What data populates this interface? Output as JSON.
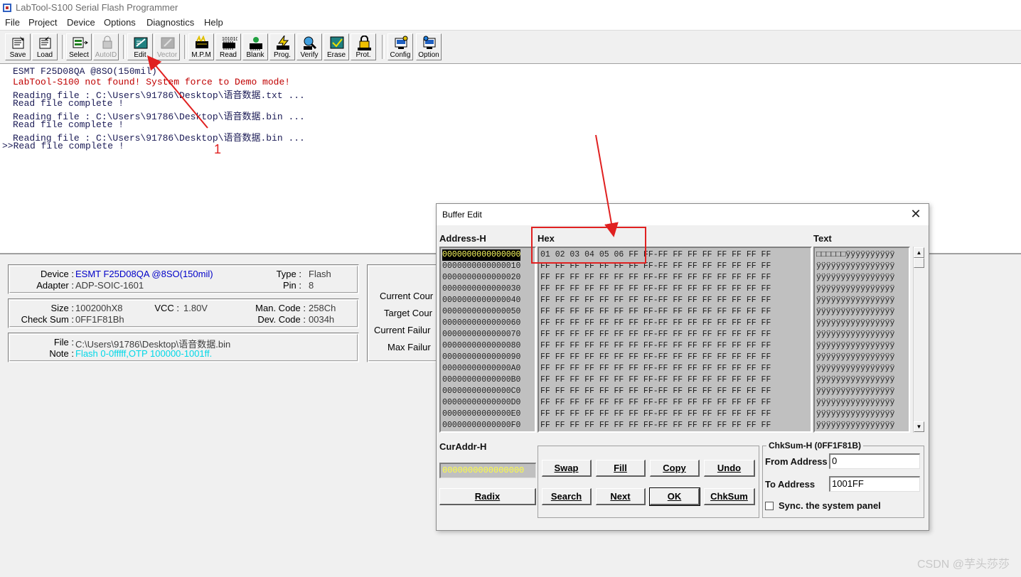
{
  "window": {
    "title": "LabTool-S100 Serial Flash Programmer"
  },
  "menu": [
    "File",
    "Project",
    "Device",
    "Options",
    "Diagnostics",
    "Help"
  ],
  "toolbar": [
    {
      "label": "Save",
      "icon": "save-icon"
    },
    {
      "label": "Load",
      "icon": "load-icon"
    },
    {
      "label": "Select",
      "icon": "select-icon"
    },
    {
      "label": "AutoID",
      "icon": "autoid-icon",
      "disabled": true
    },
    {
      "label": "Edit",
      "icon": "edit-icon"
    },
    {
      "label": "Vector",
      "icon": "vector-icon",
      "disabled": true
    },
    {
      "label": "M.P.M",
      "icon": "mpm-icon"
    },
    {
      "label": "Read",
      "icon": "read-icon",
      "badge": "101010"
    },
    {
      "label": "Blank",
      "icon": "blank-icon"
    },
    {
      "label": "Prog.",
      "icon": "prog-icon"
    },
    {
      "label": "Verify",
      "icon": "verify-icon"
    },
    {
      "label": "Erase",
      "icon": "erase-icon"
    },
    {
      "label": "Prot.",
      "icon": "prot-icon"
    },
    {
      "label": "Config",
      "icon": "config-icon"
    },
    {
      "label": "Option",
      "icon": "option-icon"
    }
  ],
  "log": [
    "ESMT F25D08QA @8SO(150mil)",
    "LabTool-S100 not found! System force to Demo mode!",
    "Reading file : C:\\Users\\91786\\Desktop\\语音数据.txt ...",
    "Read file complete !",
    "Reading file : C:\\Users\\91786\\Desktop\\语音数据.bin ...",
    "Read file complete !",
    "Reading file : C:\\Users\\91786\\Desktop\\语音数据.bin ...",
    ">>Read file complete !"
  ],
  "annotation": {
    "number": "1"
  },
  "status": {
    "device_label": "Device :",
    "device": "ESMT F25D08QA @8SO(150mil)",
    "adapter_label": "Adapter :",
    "adapter": "ADP-SOIC-1601",
    "type_label": "Type :",
    "type": "Flash",
    "pin_label": "Pin :",
    "pin": "8",
    "size_label": "Size :",
    "size": "100200hX8",
    "vcc_label": "VCC :",
    "vcc": "1.80V",
    "checksum_label": "Check Sum :",
    "checksum": "0FF1F81Bh",
    "man_code_label": "Man. Code :",
    "man_code": "258Ch",
    "dev_code_label": "Dev. Code :",
    "dev_code": "0034h",
    "file_label": "File :",
    "file": "C:\\Users\\91786\\Desktop\\语音数据.bin",
    "note_label": "Note :",
    "note": "Flash 0-0fffff,OTP 100000-1001ff.",
    "current_count_label": "Current Cour",
    "target_count_label": "Target Cour",
    "current_failure_label": "Current Failur",
    "max_failure_label": "Max Failur"
  },
  "buffer_edit": {
    "title": "Buffer Edit",
    "close": "✕",
    "address_header": "Address-H",
    "hex_header": "Hex",
    "text_header": "Text",
    "addresses": [
      "0000000000000000",
      "0000000000000010",
      "0000000000000020",
      "0000000000000030",
      "0000000000000040",
      "0000000000000050",
      "0000000000000060",
      "0000000000000070",
      "0000000000000080",
      "0000000000000090",
      "00000000000000A0",
      "00000000000000B0",
      "00000000000000C0",
      "00000000000000D0",
      "00000000000000E0",
      "00000000000000F0"
    ],
    "hex_rows": [
      "01 02 03 04 05 06 FF FF-FF FF FF FF FF FF FF FF",
      "FF FF FF FF FF FF FF FF-FF FF FF FF FF FF FF FF",
      "FF FF FF FF FF FF FF FF-FF FF FF FF FF FF FF FF",
      "FF FF FF FF FF FF FF FF-FF FF FF FF FF FF FF FF",
      "FF FF FF FF FF FF FF FF-FF FF FF FF FF FF FF FF",
      "FF FF FF FF FF FF FF FF-FF FF FF FF FF FF FF FF",
      "FF FF FF FF FF FF FF FF-FF FF FF FF FF FF FF FF",
      "FF FF FF FF FF FF FF FF-FF FF FF FF FF FF FF FF",
      "FF FF FF FF FF FF FF FF-FF FF FF FF FF FF FF FF",
      "FF FF FF FF FF FF FF FF-FF FF FF FF FF FF FF FF",
      "FF FF FF FF FF FF FF FF-FF FF FF FF FF FF FF FF",
      "FF FF FF FF FF FF FF FF-FF FF FF FF FF FF FF FF",
      "FF FF FF FF FF FF FF FF-FF FF FF FF FF FF FF FF",
      "FF FF FF FF FF FF FF FF-FF FF FF FF FF FF FF FF",
      "FF FF FF FF FF FF FF FF-FF FF FF FF FF FF FF FF",
      "FF FF FF FF FF FF FF FF-FF FF FF FF FF FF FF FF"
    ],
    "text_rows": [
      "□□□□□□ÿÿÿÿÿÿÿÿÿÿ",
      "ÿÿÿÿÿÿÿÿÿÿÿÿÿÿÿÿ",
      "ÿÿÿÿÿÿÿÿÿÿÿÿÿÿÿÿ",
      "ÿÿÿÿÿÿÿÿÿÿÿÿÿÿÿÿ",
      "ÿÿÿÿÿÿÿÿÿÿÿÿÿÿÿÿ",
      "ÿÿÿÿÿÿÿÿÿÿÿÿÿÿÿÿ",
      "ÿÿÿÿÿÿÿÿÿÿÿÿÿÿÿÿ",
      "ÿÿÿÿÿÿÿÿÿÿÿÿÿÿÿÿ",
      "ÿÿÿÿÿÿÿÿÿÿÿÿÿÿÿÿ",
      "ÿÿÿÿÿÿÿÿÿÿÿÿÿÿÿÿ",
      "ÿÿÿÿÿÿÿÿÿÿÿÿÿÿÿÿ",
      "ÿÿÿÿÿÿÿÿÿÿÿÿÿÿÿÿ",
      "ÿÿÿÿÿÿÿÿÿÿÿÿÿÿÿÿ",
      "ÿÿÿÿÿÿÿÿÿÿÿÿÿÿÿÿ",
      "ÿÿÿÿÿÿÿÿÿÿÿÿÿÿÿÿ",
      "ÿÿÿÿÿÿÿÿÿÿÿÿÿÿÿÿ"
    ],
    "curaddr_label": "CurAddr-H",
    "curaddr_value": "0000000000000000",
    "radix": "Radix",
    "buttons": {
      "swap": "Swap",
      "fill": "Fill",
      "copy": "Copy",
      "undo": "Undo",
      "search": "Search",
      "next": "Next",
      "ok": "OK",
      "chksum": "ChkSum"
    },
    "chksum_group": "ChkSum-H (0FF1F81B)",
    "from_label": "From Address",
    "from_value": "0",
    "to_label": "To Address",
    "to_value": "1001FF",
    "sync_label": "Sync. the system panel",
    "sync_checked": false
  },
  "watermark": "CSDN @芋头莎莎",
  "colors": {
    "highlight_red": "#e02020",
    "accent_blue": "#0000c8",
    "note_cyan": "#00d8e8"
  }
}
